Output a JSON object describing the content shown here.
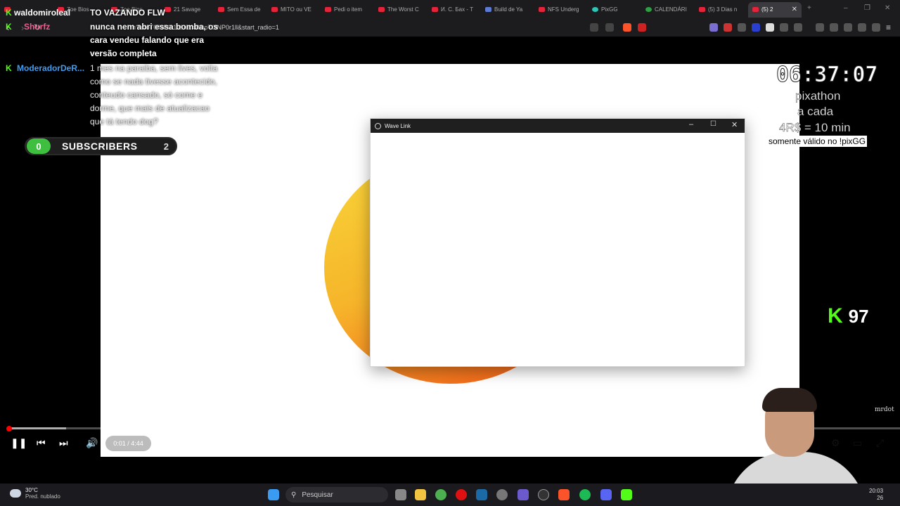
{
  "browser": {
    "tabs": [
      {
        "label": "",
        "kind": "fav"
      },
      {
        "label": "Zoe Bios",
        "kind": "fav"
      },
      {
        "label": "Zoe Bios",
        "kind": "fav"
      },
      {
        "label": "21 Savage",
        "kind": "fav"
      },
      {
        "label": "Sem Essa de",
        "kind": "fav"
      },
      {
        "label": "MITO ou VE",
        "kind": "fav"
      },
      {
        "label": "Pedi o item",
        "kind": "fav"
      },
      {
        "label": "The Worst C",
        "kind": "fav"
      },
      {
        "label": "И. С. Бах - Т",
        "kind": "fav"
      },
      {
        "label": "Build de Ya",
        "kind": "doc"
      },
      {
        "label": "NFS Underg",
        "kind": "fav"
      },
      {
        "label": "PixGG",
        "kind": "pix"
      },
      {
        "label": "CALENDÁRI",
        "kind": "cal"
      },
      {
        "label": "(5) 3 Dias n",
        "kind": "fav"
      },
      {
        "label": "(5) 2",
        "kind": "fav"
      }
    ],
    "new_tab": "+",
    "url": "h?v=oT0fNP0r1ll&list=RDoT0fNP0r1ll&start_radio=1"
  },
  "chat": {
    "top_user": "waldomiroleal",
    "top_user_msg": "TO VAZANDO FLW",
    "user2": "Shurfz",
    "user2_msg": "nunca nem abri essa bomba, os cara vendeu falando que era versão completa",
    "user3": "ModeradorDeR...",
    "user3_msg": "1 mes na paraiba, sem lives, volta como se nada tivesse acontecido, conteudo cansado, só come e dorme, que mais de atualizacao que tá tendo dog?",
    "kick_badge": "K"
  },
  "subscribers": {
    "count_left": "0",
    "label": "SUBSCRIBERS",
    "count_right": "2"
  },
  "timer": {
    "value": "06:37:07",
    "line1": "pixathon",
    "line2": "a cada",
    "line3": "4R$ = 10 min",
    "note": "somente válido no !pixGG"
  },
  "kick_viewers": {
    "icon": "K",
    "count": "97"
  },
  "watermark": "mrdot",
  "wave_link": {
    "title": "Wave Link",
    "min": "–",
    "max": "☐",
    "close": "✕"
  },
  "player": {
    "time": "0:01 / 4:44",
    "progress_fraction": 0.004
  },
  "taskbar": {
    "temp": "30°C",
    "weather": "Pred. nublado",
    "search": "Pesquisar",
    "time": "20:03",
    "date": "26"
  }
}
